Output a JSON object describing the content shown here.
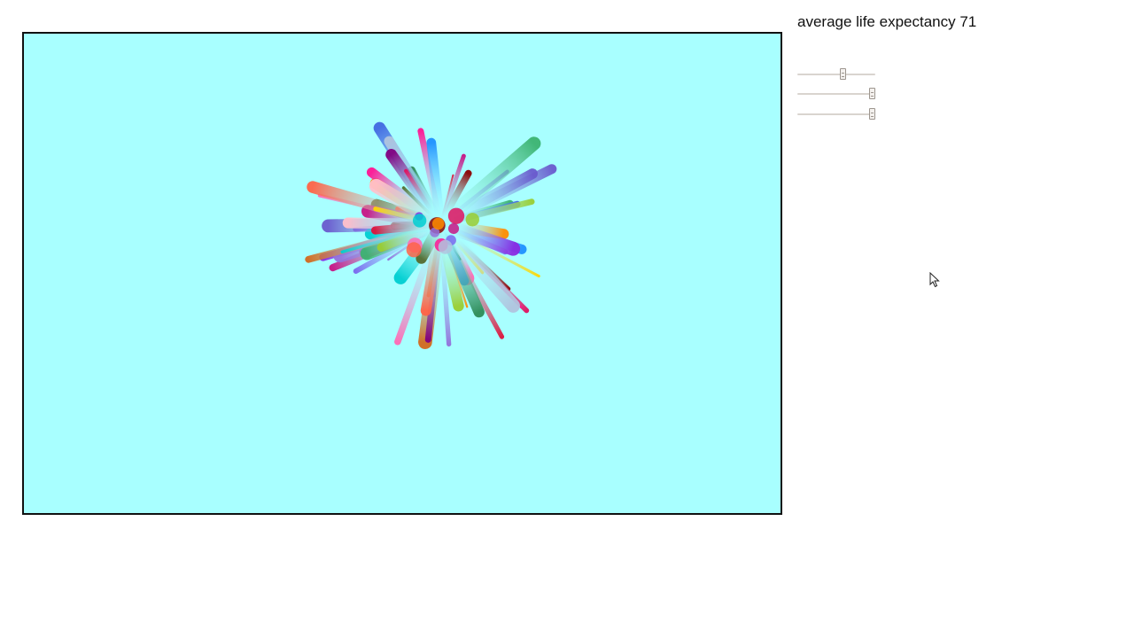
{
  "stats": {
    "avg_life_label": "average life expectancy 71"
  },
  "sliders": [
    {
      "name": "slider-1",
      "value": 0.58
    },
    {
      "name": "slider-2",
      "value": 0.96
    },
    {
      "name": "slider-3",
      "value": 0.96
    }
  ],
  "canvas": {
    "background": "#a8ffff",
    "border": "#111111"
  },
  "particle_colors": [
    "#8a2be2",
    "#e0115f",
    "#ff8c00",
    "#4169e1",
    "#2e8b57",
    "#ff69b4",
    "#8b0000",
    "#7b68ee",
    "#dc143c",
    "#556b2f",
    "#00ced1",
    "#9370db",
    "#ff1493",
    "#ffd700",
    "#1e90ff",
    "#3cb371",
    "#c71585",
    "#b0c4de",
    "#d2691e",
    "#6a5acd",
    "#ff6347",
    "#9acd32",
    "#800080",
    "#ffc0cb"
  ]
}
